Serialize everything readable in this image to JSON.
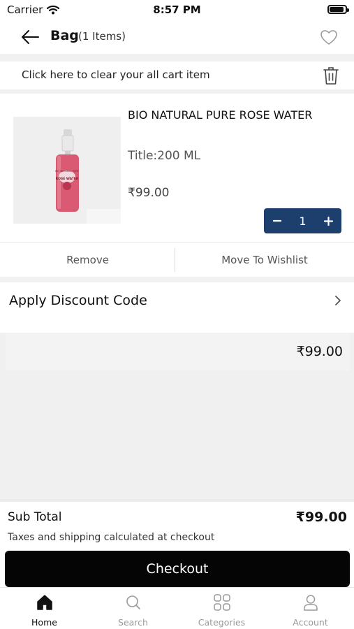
{
  "status_bar": {
    "carrier": "Carrier",
    "time": "8:57 PM",
    "battery_level": 0.9
  },
  "header": {
    "title": "Bag",
    "count": "(1 Items)"
  },
  "clear_bar": {
    "text": "Click here to clear your all cart item"
  },
  "cart_item": {
    "name": "BIO NATURAL PURE ROSE WATER",
    "variant": "Title:200 ML",
    "price": "₹99.00",
    "quantity": "1",
    "image_label": {
      "brand": "BIO NATURAL PURE",
      "product": "ROSE WATER"
    }
  },
  "actions": {
    "remove": "Remove",
    "wishlist": "Move To Wishlist"
  },
  "discount": {
    "label": "Apply Discount Code"
  },
  "summary": {
    "total": "₹99.00"
  },
  "footer": {
    "subtotal_label": "Sub Total",
    "subtotal_value": "₹99.00",
    "tax_note": "Taxes and shipping calculated at checkout",
    "checkout": "Checkout"
  },
  "tabs": [
    {
      "label": "Home",
      "icon": "home-icon",
      "active": true
    },
    {
      "label": "Search",
      "icon": "search-icon",
      "active": false
    },
    {
      "label": "Categories",
      "icon": "categories-icon",
      "active": false
    },
    {
      "label": "Account",
      "icon": "account-icon",
      "active": false
    }
  ],
  "colors": {
    "qty_bg": "#1c3f6e",
    "checkout_bg": "#050505",
    "bottle": "#d95a72"
  }
}
